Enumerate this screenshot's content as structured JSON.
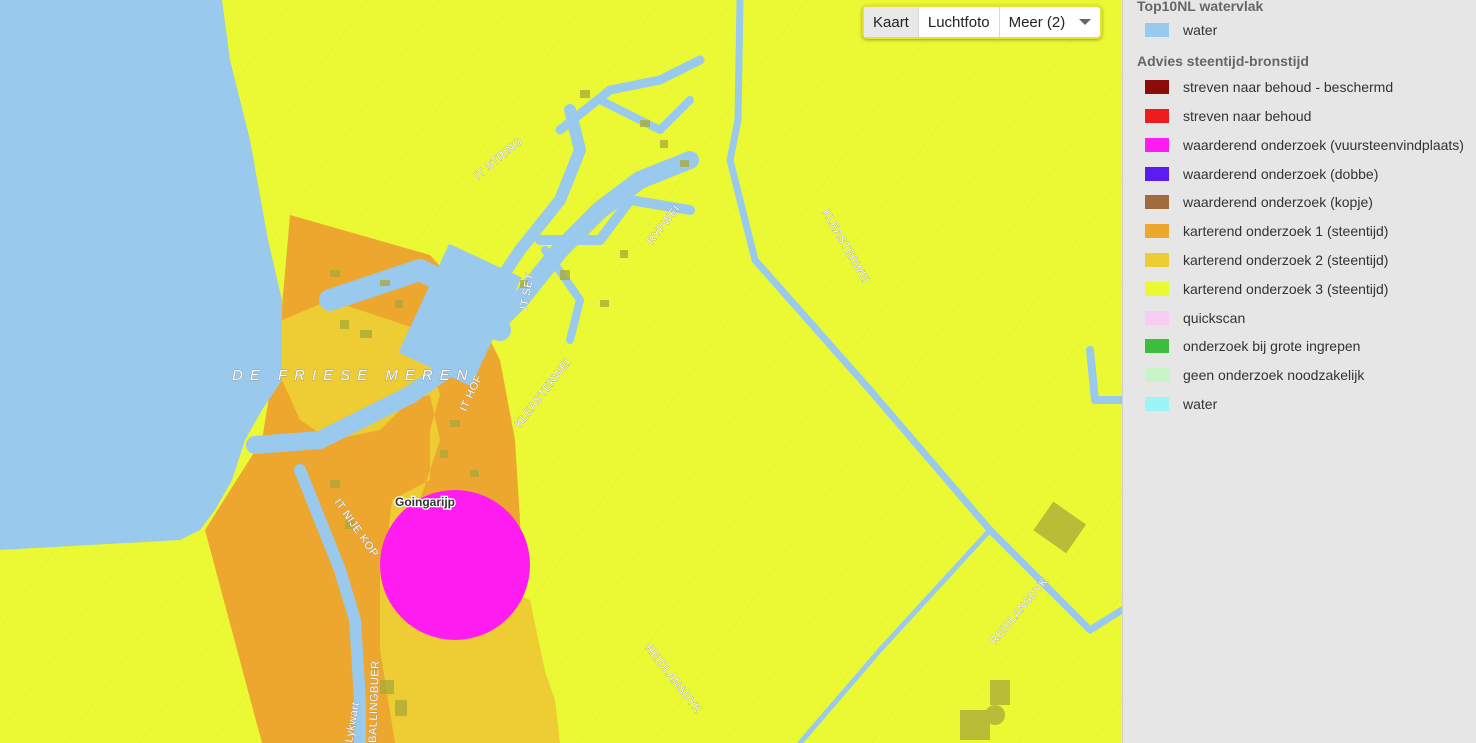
{
  "map": {
    "labels": {
      "lake": "DE FRIESE MEREN",
      "place": "Goingarijp",
      "it_string": "IT STRING",
      "rypwei": "RYPWEI",
      "it_set": "IT SET",
      "it_hof": "IT HOF",
      "kleasterwei_1": "KLEASTERWEI",
      "kleasterwei_2": "KLEASTERWEI",
      "it_nije_kop": "IT NIJE KOP",
      "reidlansdyk_1": "REIDLANSDYK",
      "reidlansdyk_2": "REIDLANSDYK",
      "lykwart": "Lykwart",
      "ballingbuer": "BALLINGBUER"
    },
    "colors": {
      "water": "#99c9ec",
      "karterend_3": "#eaf933",
      "karterend_2": "#edcd33",
      "karterend_1": "#eda62e",
      "vuursteen": "#ff1cf0",
      "building": "#a9a73a"
    }
  },
  "map_type": {
    "options": [
      "Kaart",
      "Luchtfoto",
      "Meer (2)"
    ],
    "active": "Kaart"
  },
  "legend": {
    "group1_title": "Top10NL watervlak",
    "group1_items": [
      {
        "label": "water",
        "color": "#99c9ec"
      }
    ],
    "group2_title": "Advies steentijd-bronstijd",
    "group2_items": [
      {
        "label": "streven naar behoud - beschermd",
        "color": "#8b0a0a"
      },
      {
        "label": "streven naar behoud",
        "color": "#ee1c1c"
      },
      {
        "label": "waarderend onderzoek (vuursteenvindplaats)",
        "color": "#ff1cf0"
      },
      {
        "label": "waarderend onderzoek (dobbe)",
        "color": "#5a1cf0"
      },
      {
        "label": "waarderend onderzoek (kopje)",
        "color": "#a36a3c"
      },
      {
        "label": "karterend onderzoek 1 (steentijd)",
        "color": "#eda62e"
      },
      {
        "label": "karterend onderzoek 2 (steentijd)",
        "color": "#edcd33"
      },
      {
        "label": "karterend onderzoek 3 (steentijd)",
        "color": "#eaf933"
      },
      {
        "label": "quickscan",
        "color": "#f7ccf5"
      },
      {
        "label": "onderzoek bij grote ingrepen",
        "color": "#3cbd3c"
      },
      {
        "label": "geen onderzoek noodzakelijk",
        "color": "#c8f5c8"
      },
      {
        "label": "water",
        "color": "#9cf5f5"
      }
    ]
  }
}
